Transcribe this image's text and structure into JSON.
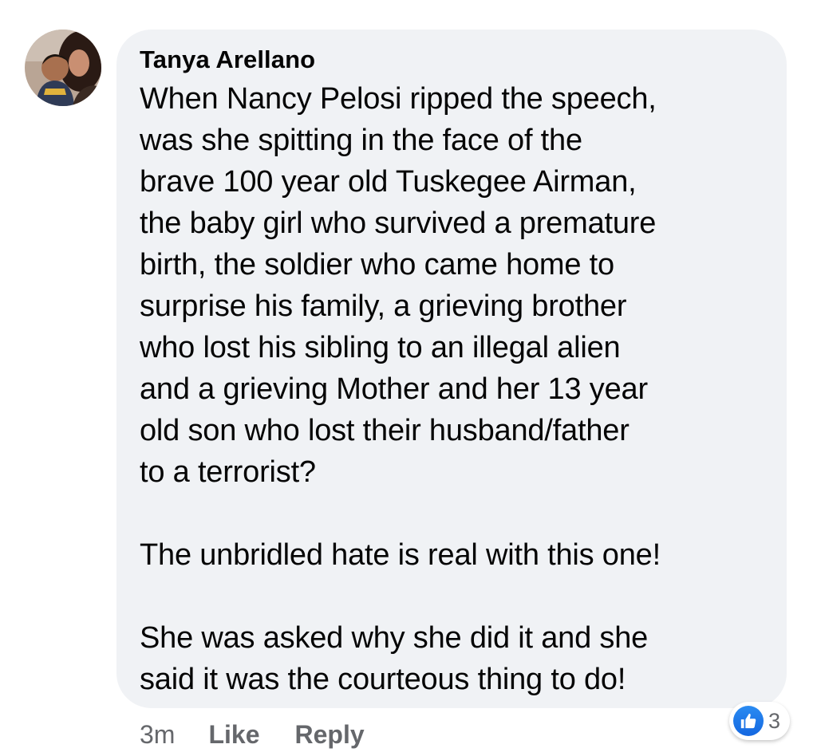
{
  "comment": {
    "author": "Tanya Arellano",
    "paragraphs": [
      "When Nancy Pelosi ripped the speech,\nwas she spitting in the face of the\nbrave 100 year old Tuskegee Airman,\nthe baby girl who survived a premature\nbirth, the soldier who came home to\nsurprise his family, a grieving brother\nwho lost his sibling to an illegal alien\nand a grieving Mother and her 13 year\nold son who lost their husband/father\nto a terrorist?",
      "The unbridled hate is real with this one!",
      "She was asked why she did it and she\nsaid it was the courteous thing to do!"
    ],
    "timestamp": "3m",
    "like_label": "Like",
    "reply_label": "Reply",
    "reaction_count": "3",
    "reaction_icon": "like-icon",
    "avatar_icon": "profile-photo"
  },
  "colors": {
    "bubble": "#f0f2f5",
    "text": "#050505",
    "muted": "#65676b",
    "like_blue": "#1877f2"
  }
}
